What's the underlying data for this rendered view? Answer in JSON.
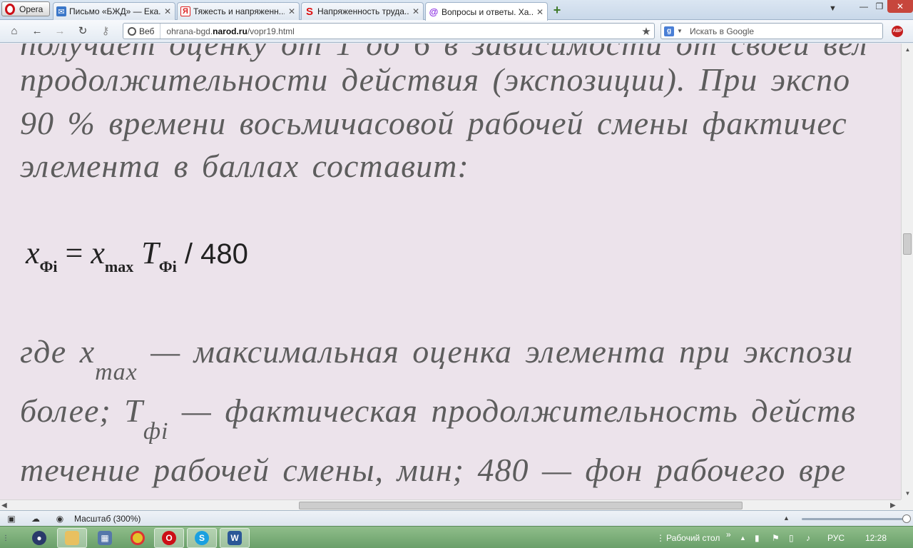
{
  "browser": {
    "menu_label": "Opera",
    "tabs": [
      {
        "favicon": "mail-icon",
        "title": "Письмо «БЖД» — Ека...",
        "active": false
      },
      {
        "favicon": "yandex-icon",
        "title": "Тяжесть и напряженн...",
        "active": false
      },
      {
        "favicon": "s-icon",
        "title": "Напряженность труда...",
        "active": false
      },
      {
        "favicon": "narod-icon",
        "title": "Вопросы и ответы. Ха...",
        "active": true
      }
    ],
    "new_tab_symbol": "+",
    "address": {
      "badge": "Веб",
      "url_prefix": "ohrana-bgd.",
      "url_domain": "narod.ru",
      "url_path": "/vopr19.html"
    },
    "search": {
      "engine_letter": "g",
      "placeholder": "Искать в Google"
    },
    "adblock_label": "ABP"
  },
  "page": {
    "line0": "получает оценку от 1 до 6 в зависимости от своей вел",
    "line1": "продолжительности действия (экспозиции). При экспо",
    "line2": "90 % времени восьмичасовой рабочей смены фактичес",
    "line3": "элемента в баллах составит:",
    "formula": {
      "x": "x",
      "sub_phi": "Фi",
      "eq": " = ",
      "xmax": "x",
      "sub_max": "max",
      "t": " T",
      "sub_phi2": "Фi",
      "div": " / 480"
    },
    "line4_pre": "где x",
    "line4_sub": "max",
    "line4_post": " — максимальная оценка элемента при экспози",
    "line5_pre": "более; T",
    "line5_sub": "фi",
    "line5_post": " — фактическая продолжительность действ",
    "line6": "течение рабочей смены, мин; 480 — фон рабочего вре"
  },
  "status": {
    "zoom_label": "Масштаб (300%)"
  },
  "taskbar": {
    "desktop_label": "Рабочий стол",
    "language": "РУС",
    "time": "12:28"
  },
  "colors": {
    "page_bg": "#ece3eb",
    "text": "#5d5d5d",
    "taskbar": "#7aab76",
    "opera_red": "#cc0f16"
  }
}
